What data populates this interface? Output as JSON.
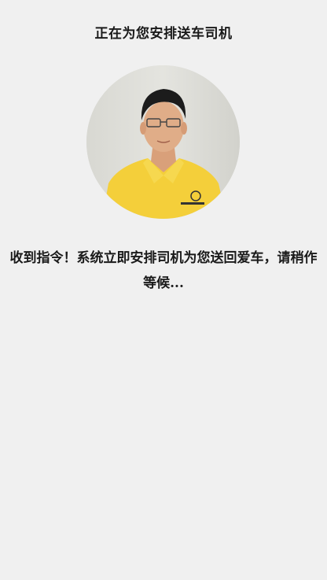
{
  "header": {
    "title": "正在为您安排送车司机"
  },
  "driver": {
    "avatar_icon": "driver-photo",
    "shirt_color": "#f4cf3a"
  },
  "status": {
    "message": "收到指令！系统立即安排司机为您送回爱车，请稍作等候..."
  }
}
